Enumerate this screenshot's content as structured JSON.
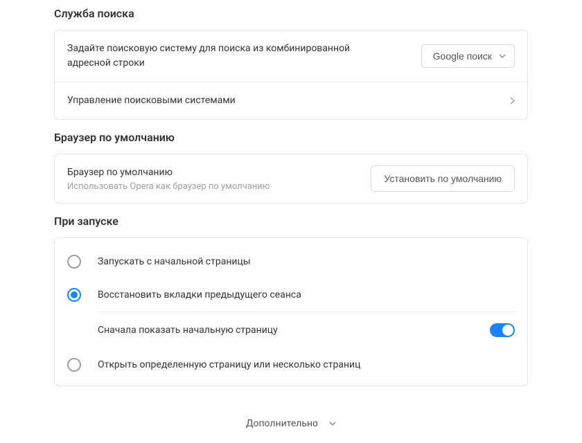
{
  "search": {
    "title": "Служба поиска",
    "engine_label": "Задайте поисковую систему для поиска из комбинированной адресной строки",
    "engine_value": "Google поиск",
    "manage_label": "Управление поисковыми системами"
  },
  "default_browser": {
    "title": "Браузер по умолчанию",
    "label": "Браузер по умолчанию",
    "sub": "Использовать Opera как браузер по умолчанию",
    "button": "Установить по умолчанию"
  },
  "startup": {
    "title": "При запуске",
    "options": [
      "Запускать с начальной страницы",
      "Восстановить вкладки предыдущего сеанса",
      "Открыть определенную страницу или несколько страниц"
    ],
    "show_startpage_first": "Сначала показать начальную страницу"
  },
  "footer": {
    "more": "Дополнительно"
  }
}
